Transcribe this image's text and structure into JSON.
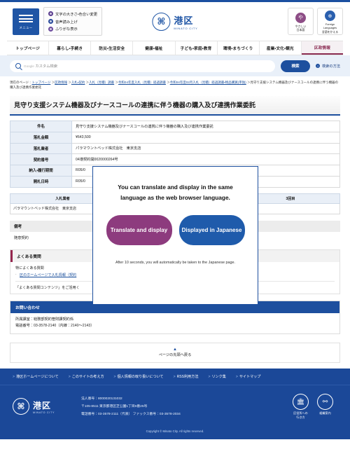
{
  "header": {
    "menu_label": "メニュー",
    "accessibility": [
      {
        "icon": "text-size-color-icon",
        "label": "文字の大きさ・色合い変更"
      },
      {
        "icon": "speaker-icon",
        "label": "音声読み上げ"
      },
      {
        "icon": "furigana-icon",
        "label": "ふりがな表示"
      }
    ],
    "logo": {
      "name": "港区",
      "sub": "MINATO CITY",
      "mark": "⌘"
    },
    "lang_buttons": [
      {
        "icon": "や",
        "line1": "やさしい",
        "line2": "日本語"
      },
      {
        "icon": "⊕",
        "line1": "Foreign",
        "line2": "Languages",
        "line3": "言語をかえる"
      }
    ]
  },
  "nav": {
    "items": [
      {
        "label": "トップページ",
        "active": false
      },
      {
        "label": "暮らし・手続き",
        "active": false
      },
      {
        "label": "防災・生活安全",
        "active": false
      },
      {
        "label": "健康・福祉",
        "active": false
      },
      {
        "label": "子ども・家庭・教育",
        "active": false
      },
      {
        "label": "環境・まちづくり",
        "active": false
      },
      {
        "label": "産業・文化・観光",
        "active": false
      },
      {
        "label": "区政情報",
        "active": true
      }
    ]
  },
  "search": {
    "google_label": "Google",
    "placeholder": "カスタム検索",
    "button_label": "検索",
    "how_label": "検索の方法"
  },
  "breadcrumb": {
    "prefix": "現在のページ：",
    "items": [
      "トップページ",
      "区政情報",
      "入札・契約",
      "入札（見積）調書",
      "令和04年度入札（見積）経過調書",
      "令和04年度02月入札（見積）経過調書・物品購買(単独)"
    ],
    "current": "見守り支援システム機器及びナースコールの連携に伴う機器の購入及び連携作業委託",
    "separator": "＞"
  },
  "page_title": "見守り支援システム機器及びナースコールの連携に伴う機器の購入及び連携作業委託",
  "info_table": {
    "rows": [
      {
        "label": "件名",
        "value": "見守り支援システム機器及びナースコールの連携に伴う機器の購入及び連携作業委託"
      },
      {
        "label": "落札金額",
        "value": "¥643,500"
      },
      {
        "label": "落札業者",
        "value": "パラマウントベッド株式会社　東京支店"
      },
      {
        "label": "契約番号",
        "value": "04港契約開0020000264号"
      },
      {
        "label": "納入・履行期間",
        "value": "R05/0"
      },
      {
        "label": "開札日時",
        "value": "R05/0"
      }
    ]
  },
  "bids_table": {
    "headers": [
      "入札業者",
      "",
      "",
      "3回目"
    ],
    "rows": [
      [
        "パラマウントベッド株式会社　東京支店",
        "",
        "",
        ""
      ]
    ]
  },
  "remarks": {
    "title": "備考",
    "value": "随意契約"
  },
  "faq": {
    "title": "よくある質問",
    "subtitle": "特によくある質問",
    "link": "区のホームページで入札情報（契約",
    "note": "「よくある質問コンテンツ」をご活用く"
  },
  "contact": {
    "title": "お問い合わせ",
    "dept": "所属課室：総務部契約管財課契約係",
    "tel": "電話番号：03-3578-2140（内線：2140〜2143）"
  },
  "back_to_top": {
    "arrow": "▲",
    "label": "ページの先頭へ戻る"
  },
  "footer": {
    "links": [
      "港区ホームページについて",
      "このサイトの考え方",
      "個人情報の取り扱いについて",
      "RSS利用方法",
      "リンク集",
      "サイトマップ"
    ],
    "logo": {
      "name": "港区",
      "sub": "MINATO CITY",
      "mark": "⌘"
    },
    "corp_number": "法人番号：8000020131032",
    "address": "〒105-8511 東京都港区芝公園1丁目5番25号",
    "phone": "電話番号：03-3578-2111（代表） ファックス番号：03-3578-2034",
    "icons": [
      {
        "glyph": "🏛",
        "line1": "区役所への",
        "line2": "行き方"
      },
      {
        "glyph": "⚯",
        "line1": "組織案内",
        "line2": ""
      }
    ],
    "copyright": "Copyright © Minato City. All rights reserved."
  },
  "modal": {
    "message": "You can translate and display in the same language as the web browser language.",
    "translate_button": "Translate and display",
    "japanese_button": "Displayed in Japanese",
    "footnote": "After 10 seconds, you will automatically be taken to the Japanese page."
  },
  "colors": {
    "brand_blue": "#1d4f9e",
    "footer_blue": "#1b4898",
    "accent_crimson": "#95264e",
    "modal_purple": "#8d3b7e"
  }
}
